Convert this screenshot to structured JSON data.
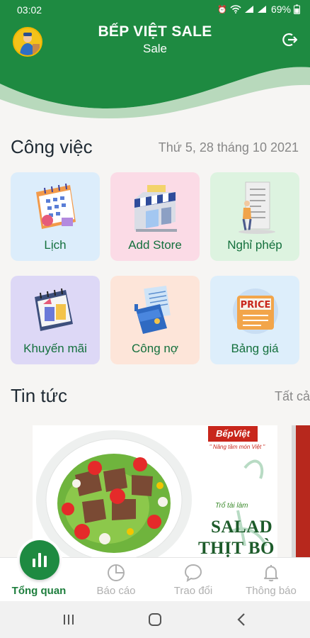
{
  "status_bar": {
    "time": "03:02",
    "battery": "69%"
  },
  "header": {
    "title": "BẾP VIỆT SALE",
    "subtitle": "Sale"
  },
  "work": {
    "title": "Công việc",
    "date": "Thứ 5, 28 tháng 10 2021",
    "tiles": [
      {
        "label": "Lịch",
        "icon": "calendar-icon",
        "bg": "#dcedfb"
      },
      {
        "label": "Add Store",
        "icon": "store-icon",
        "bg": "#fbdbe6"
      },
      {
        "label": "Nghỉ phép",
        "icon": "leave-form-icon",
        "bg": "#ddf3e0"
      },
      {
        "label": "Khuyến mãi",
        "icon": "gift-calendar-icon",
        "bg": "#ddd8f6"
      },
      {
        "label": "Công nợ",
        "icon": "wallet-icon",
        "bg": "#fde5d9"
      },
      {
        "label": "Bảng giá",
        "icon": "price-tag-icon",
        "bg": "#ddeefb"
      }
    ]
  },
  "news": {
    "title": "Tin tức",
    "see_all": "Tất cả",
    "card": {
      "brand": "BếpViệt",
      "slogan": "\" Nâng tầm món Việt \"",
      "tag": "Trổ tài làm",
      "line1": "SALAD",
      "line2": "THỊT BÒ"
    }
  },
  "bottom_nav": [
    {
      "label": "Tổng quan",
      "icon": "bar-chart-icon",
      "active": true
    },
    {
      "label": "Báo cáo",
      "icon": "pie-chart-icon",
      "active": false
    },
    {
      "label": "Trao đổi",
      "icon": "chat-bubble-icon",
      "active": false
    },
    {
      "label": "Thông báo",
      "icon": "bell-icon",
      "active": false
    }
  ],
  "colors": {
    "primary": "#1e8a41",
    "tile_text": "#14703d",
    "background": "#f6f5f3"
  }
}
